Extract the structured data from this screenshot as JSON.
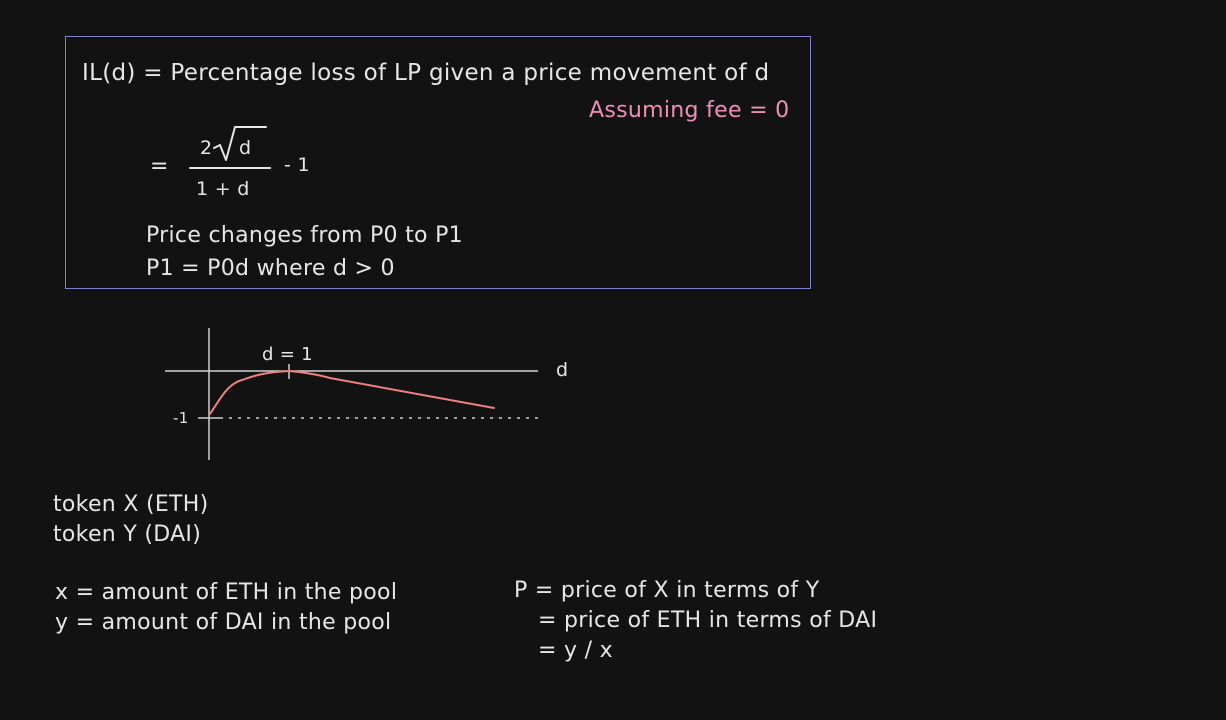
{
  "box": {
    "definition": "IL(d) = Percentage loss of LP given a price movement of d",
    "assumption": "Assuming fee = 0",
    "equals": "=",
    "numerator_coef": "2",
    "numerator_var": "d",
    "denominator": "1 + d",
    "minus_one": "- 1",
    "price_change": "Price changes from P0 to P1",
    "price_relation": "P1 = P0d where d > 0"
  },
  "graph": {
    "x_label": "d",
    "tick_label": "d = 1",
    "y_label": "-1"
  },
  "tokens": {
    "token_x": "token X (ETH)",
    "token_y": "token Y (DAI)"
  },
  "amounts": {
    "x_def": "x = amount of ETH in the pool",
    "y_def": "y = amount of DAI in the pool"
  },
  "price": {
    "line1": "P = price of X in terms of Y",
    "line2": "= price of ETH in terms of DAI",
    "line3": "= y / x"
  },
  "colors": {
    "box_border": "#7f82c9",
    "accent": "#f08fb5",
    "curve": "#f07f7f",
    "text": "#e6e6e6"
  }
}
